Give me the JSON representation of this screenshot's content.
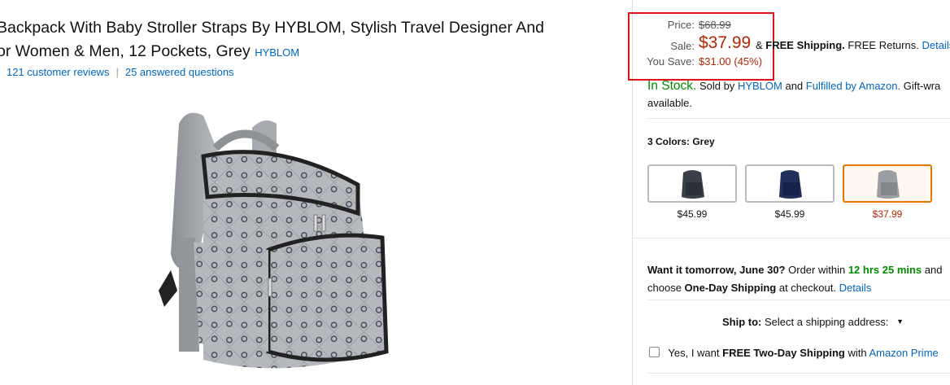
{
  "product": {
    "title_line1": "Backpack With Baby Stroller Straps By HYBLOM, Stylish Travel Designer And",
    "title_line2": "or Women & Men, 12 Pockets, Grey",
    "brand": "HYBLOM",
    "reviews": "121 customer reviews",
    "reviews_sep": "|",
    "questions": "25 answered questions",
    "image_icon": "grey-backpack-image"
  },
  "pricing": {
    "price_label": "Price:",
    "list_price": "$68.99",
    "sale_label": "Sale:",
    "sale_price": "$37.99",
    "shipping_pre": "&",
    "shipping_bold": "FREE Shipping.",
    "shipping_returns": "FREE Returns.",
    "details": "Details",
    "save_label": "You Save:",
    "save_value": "$31.00 (45%)",
    "highlight_color": "#e2121b"
  },
  "availability": {
    "stock": "In Stock.",
    "sold_by_pre": "Sold by",
    "seller": "HYBLOM",
    "and": "and",
    "fulfilled": "Fulfilled by Amazon.",
    "gift_line1": "Gift-wra",
    "gift_line2": "available."
  },
  "colors": {
    "label": "3 Colors: Grey",
    "swatches": [
      {
        "name": "black",
        "price": "$45.99",
        "color": "#3a3f47"
      },
      {
        "name": "navy",
        "price": "$45.99",
        "color": "#1f2f5a"
      },
      {
        "name": "grey",
        "price": "$37.99",
        "color": "#9a9da1"
      }
    ]
  },
  "delivery": {
    "want_bold": "Want it tomorrow, June 30?",
    "order_within": "Order within",
    "time": "12 hrs 25 mins",
    "and": "and",
    "choose": "choose",
    "one_day": "One-Day Shipping",
    "at_checkout": "at checkout.",
    "details": "Details"
  },
  "ship_to": {
    "label": "Ship to:",
    "value": "Select a shipping address:",
    "icon": "caret-down-icon"
  },
  "prime": {
    "pre": "Yes, I want",
    "bold": "FREE Two-Day Shipping",
    "with": "with",
    "link": "Amazon Prime"
  }
}
